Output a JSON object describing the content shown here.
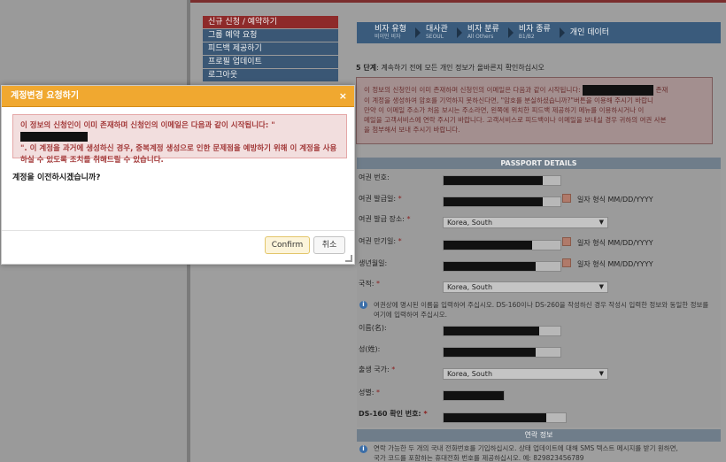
{
  "nav": {
    "items": [
      {
        "label": "신규 신청 / 예약하기",
        "active": true
      },
      {
        "label": "그룹 예약 요청",
        "active": false
      },
      {
        "label": "피드백 제공하기",
        "active": false
      },
      {
        "label": "프로필 업데이트",
        "active": false
      },
      {
        "label": "로그아웃",
        "active": false
      }
    ]
  },
  "breadcrumb": [
    {
      "title": "비자 유형",
      "sub": "비이민 비자"
    },
    {
      "title": "대사관",
      "sub": "SEOUL"
    },
    {
      "title": "비자 분류",
      "sub": "All Others"
    },
    {
      "title": "비자 종류",
      "sub": "B1/B2"
    },
    {
      "title": "개인 데이터",
      "sub": ""
    }
  ],
  "step": {
    "label": "5 단계",
    "text": ": 계속하기 전에 모든 개인 정보가 올바른지 확인하십시오"
  },
  "warning": {
    "line1": "이 정보의 신청인이 이미 존재하며 신청인의 이메일은 다음과 같이 시작됩니다:",
    "line1_end": "존재",
    "line2": "이 계정을 생성하여 암호를 기억하지 못하신다면, \"암호를 분실하셨습니까?\"버튼을 이용해 주시기 바랍니",
    "line3": "만약 이 이메일 주소가 처음 보시는 주소라면, 왼쪽에 위치한 피드백 제공하기 메뉴를 이용하시거나 이",
    "line4": "메일을 고객서비스에 연락 주시기 바랍니다. 고객서비스로 피드백이나 이메일을 보내실 경우 귀하의 여권 사본",
    "line5": "을 첨부해서 보내 주시기 바랍니다."
  },
  "passport": {
    "header": "PASSPORT DETAILS",
    "passport_number": "여권 번호:",
    "issue_date": "여권 발급일:",
    "issue_place": "여권 발급 장소:",
    "issue_place_value": "Korea, South",
    "expiry_date": "여권 만기일:",
    "birth_date": "생년월일:",
    "nationality": "국적:",
    "nationality_value": "Korea, South",
    "date_hint": "일자 형식 MM/DD/YYYY",
    "info_text": "여권상에 명시된 이름을 입력하여 주십시오. DS-160이나 DS-260을 작성하신 경우 작성시 입력한 정보와 동일한 정보를 여기에 입력하여 주십시오.",
    "given_name": "이름(名):",
    "surname": "성(姓):",
    "birth_country": "출생 국가:",
    "birth_country_value": "Korea, South",
    "gender": "성별:",
    "ds160": "DS-160 확인 번호:",
    "required_mark": "*"
  },
  "contact": {
    "header": "연락 정보",
    "info_text": "연락 가능한 두 개의 국내 전화번호를 기입하십시오. 상태 업데이트에 대해 SMS 텍스트 메시지를 받기 원하면,",
    "info_text2": "국가 코드를 포함하는 휴대전화 번호를 제공하십시오. 예: 829823456789"
  },
  "modal": {
    "title": "계정변경 요청하기",
    "close": "×",
    "alert_line1": "이 정보의 신청인이 이미 존재하며 신청인의 이메일은 다음과 같이 시작됩니다: \"",
    "alert_line2": "\". 이 계정을 과거에 생성하신 경우, 중복계정 생성으로 인한 문제점을 예방하기 위해 이 계정을 사용",
    "alert_line3": "하실 수 있도록 조치를 취해드릴 수 있습니다.",
    "question": "계정을 이전하시겠습니까?",
    "confirm": "Confirm",
    "cancel": "취소"
  }
}
